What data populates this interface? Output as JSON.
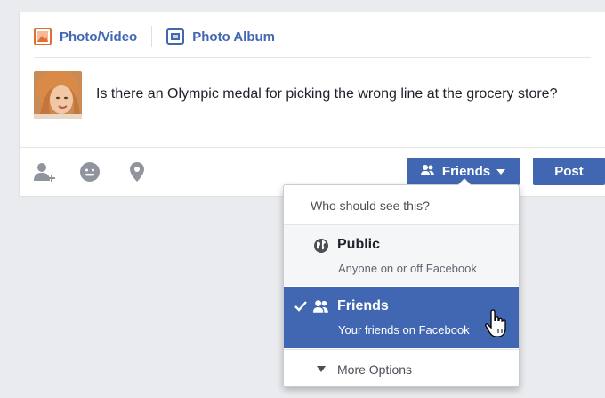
{
  "composer": {
    "tabs": [
      {
        "label": "Photo/Video",
        "icon": "photo-video-icon",
        "color": "#e36d2f"
      },
      {
        "label": "Photo Album",
        "icon": "photo-album-icon",
        "color": "#4267b2"
      }
    ],
    "post_text": "Is there an Olympic medal for picking the wrong line at the grocery store?",
    "footer_icons": [
      "tag-friends-icon",
      "feeling-icon",
      "location-pin-icon"
    ],
    "audience_button": {
      "label": "Friends",
      "icon": "friends-icon"
    },
    "post_button": {
      "label": "Post"
    }
  },
  "audience_dropdown": {
    "header": "Who should see this?",
    "options": [
      {
        "title": "Public",
        "subtitle": "Anyone on or off Facebook",
        "icon": "globe-icon",
        "selected": false
      },
      {
        "title": "Friends",
        "subtitle": "Your friends on Facebook",
        "icon": "friends-icon",
        "selected": true
      }
    ],
    "more": "More Options"
  },
  "colors": {
    "accent": "#4267b2",
    "background": "#e9ebee",
    "text": "#1d2129",
    "muted": "#606770"
  }
}
